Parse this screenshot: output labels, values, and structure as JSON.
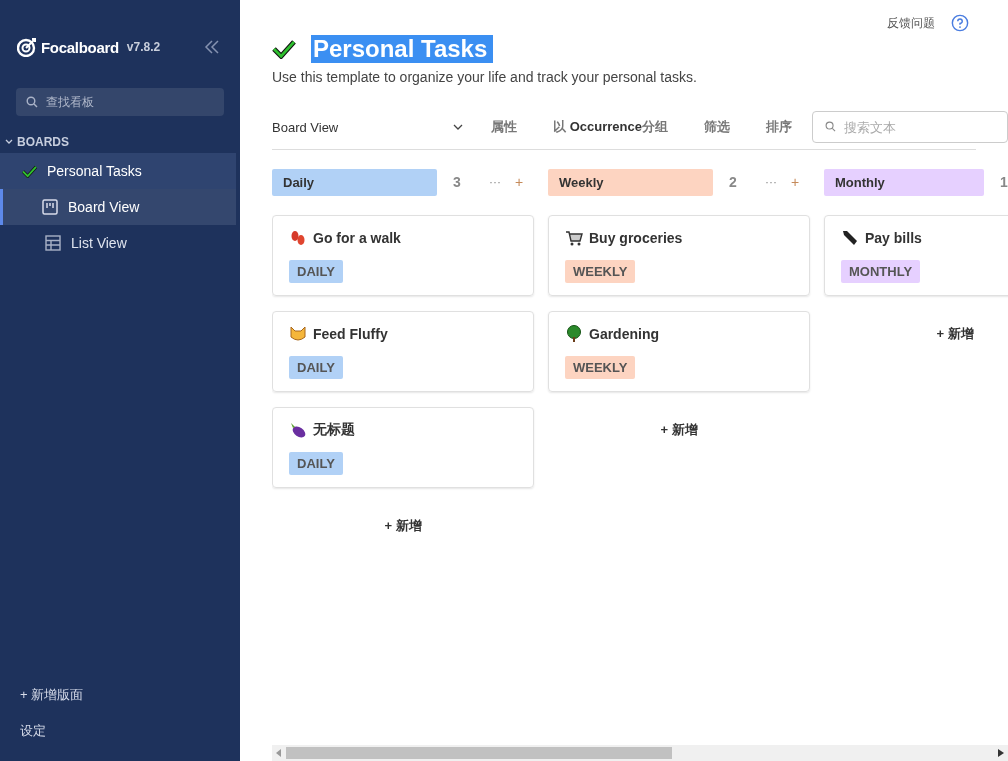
{
  "sidebar": {
    "logo": "Focalboard",
    "version": "v7.8.2",
    "search": {
      "placeholder": "查找看板"
    },
    "section": {
      "label": "BOARDS",
      "expanded": true
    },
    "boards": [
      {
        "label": "Personal Tasks",
        "selected": true,
        "children": [
          {
            "label": "Board View",
            "kind": "board",
            "selected": true
          },
          {
            "label": "List View",
            "kind": "table",
            "selected": false
          }
        ]
      }
    ],
    "add_board": "+ 新增版面",
    "settings": "设定"
  },
  "header": {
    "feedback": "反馈问题",
    "title": "Personal Tasks",
    "title_selected": true,
    "description": "Use this template to organize your life and track your personal tasks."
  },
  "toolbar": {
    "view": "Board View",
    "buttons": [
      "属性",
      "以 **Occurrence**分组",
      "筛选",
      "排序"
    ],
    "search": {
      "placeholder": "搜索文本"
    }
  },
  "columns": [
    {
      "name": "Daily",
      "color": "#b1d1f6",
      "count": "3",
      "menu": "···",
      "add": "+",
      "cards": [
        {
          "title": "Go for a walk",
          "tag": "DAILY"
        },
        {
          "title": "Feed Fluffy",
          "tag": "DAILY"
        },
        {
          "title": "无标题",
          "tag": "DAILY"
        }
      ],
      "new": "+ 新增"
    },
    {
      "name": "Weekly",
      "color": "#fdd4c1",
      "count": "2",
      "menu": "···",
      "add": "+",
      "cards": [
        {
          "title": "Buy groceries",
          "tag": "WEEKLY"
        },
        {
          "title": "Gardening",
          "tag": "WEEKLY"
        }
      ],
      "new": "+ 新增"
    },
    {
      "name": "Monthly",
      "color": "#e6d0ff",
      "count": "1",
      "cards": [
        {
          "title": "Pay bills",
          "tag": "MONTHLY"
        }
      ],
      "new": "+ 新增"
    }
  ]
}
